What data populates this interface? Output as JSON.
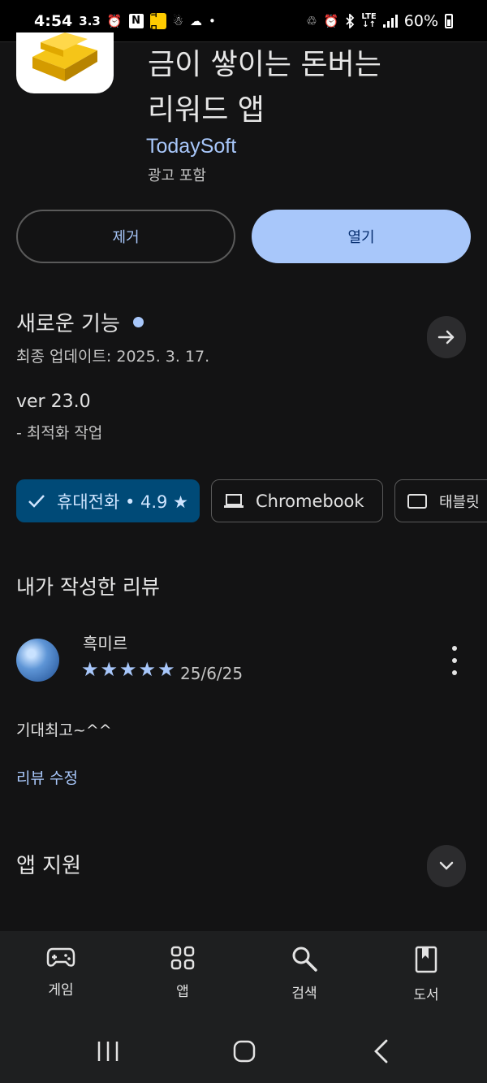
{
  "status_bar": {
    "time": "4:54",
    "extra": "3.3",
    "n_icon": "N",
    "yellow_icon": "ㅋㅁ",
    "more_dot": "•",
    "lte": "LTE",
    "battery": "60%"
  },
  "app": {
    "title_line1": "금이 쌓이는 돈버는",
    "title_line2": "리워드 앱",
    "developer": "TodaySoft",
    "ads_label": "광고 포함"
  },
  "buttons": {
    "remove": "제거",
    "open": "열기"
  },
  "whats_new": {
    "title": "새로운 기능",
    "last_updated": "최종 업데이트: 2025. 3. 17.",
    "version": "ver 23.0",
    "note": "- 최적화 작업"
  },
  "device_chips": {
    "phone": "휴대전화 • 4.9 ★",
    "chromebook": "Chromebook",
    "tablet": "태블릿"
  },
  "my_review": {
    "heading": "내가 작성한 리뷰",
    "reviewer": "흑미르",
    "rating": 5,
    "stars": [
      "★",
      "★",
      "★",
      "★",
      "★"
    ],
    "date": "25/6/25",
    "text": "기대최고~^^",
    "edit_link": "리뷰 수정"
  },
  "app_support": {
    "title": "앱 지원"
  },
  "bottom_nav": [
    {
      "label": "게임",
      "icon": "gamepad-icon"
    },
    {
      "label": "앱",
      "icon": "apps-grid-icon"
    },
    {
      "label": "검색",
      "icon": "search-icon"
    },
    {
      "label": "도서",
      "icon": "book-icon"
    }
  ],
  "colors": {
    "background": "#131314",
    "accent": "#a8c7fa",
    "primary_button": "#a8c7fa",
    "selected_chip": "#004a77"
  }
}
